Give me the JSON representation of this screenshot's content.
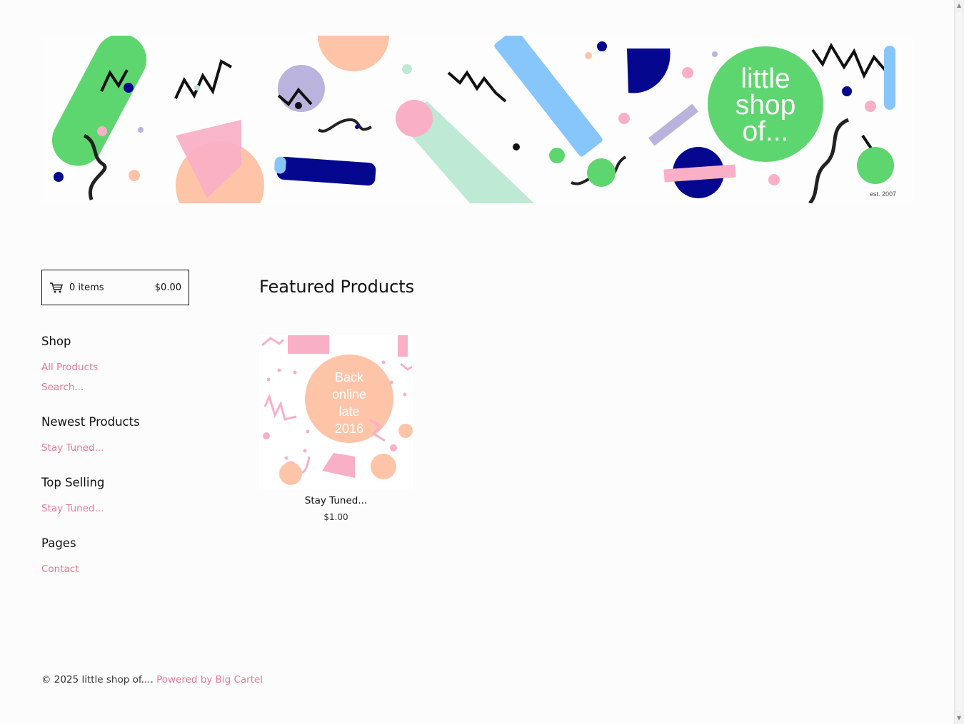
{
  "banner": {
    "logo_line1": "little",
    "logo_line2": "shop",
    "logo_line3": "of...",
    "est": "est. 2007"
  },
  "cart": {
    "icon": "cart-icon",
    "count_label": "0 items",
    "total": "$0.00"
  },
  "sidebar": {
    "shop": {
      "heading": "Shop",
      "links": [
        "All Products",
        "Search..."
      ]
    },
    "newest": {
      "heading": "Newest Products",
      "links": [
        "Stay Tuned..."
      ]
    },
    "top_selling": {
      "heading": "Top Selling",
      "links": [
        "Stay Tuned..."
      ]
    },
    "pages": {
      "heading": "Pages",
      "links": [
        "Contact"
      ]
    }
  },
  "main": {
    "title": "Featured Products",
    "products": [
      {
        "name": "Stay Tuned...",
        "price": "$1.00",
        "image_text": [
          "Back",
          "online",
          "late",
          "2016"
        ]
      }
    ]
  },
  "footer": {
    "copyright": "© 2025 little shop of....",
    "powered": "Powered by Big Cartel"
  },
  "colors": {
    "link": "#e57a95",
    "green": "#5ed66f",
    "navy": "#06078f",
    "peach": "#fec4a8",
    "pink": "#f9afc6",
    "lavender": "#b9b3dd",
    "sky": "#86c6fb",
    "mint": "#bde9d5"
  }
}
